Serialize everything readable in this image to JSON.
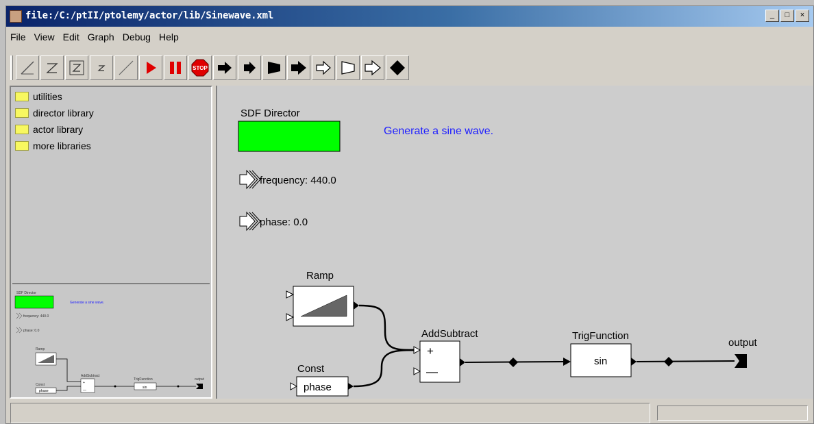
{
  "window": {
    "title": "file:/C:/ptII/ptolemy/actor/lib/Sinewave.xml",
    "buttons": {
      "minimize": "_",
      "maximize": "□",
      "close": "×"
    }
  },
  "menu": [
    "File",
    "View",
    "Edit",
    "Graph",
    "Debug",
    "Help"
  ],
  "toolbar": {
    "buttons": [
      "zoom-reset",
      "zoom-in",
      "zoom-fit",
      "zoom-out",
      "zoom-full",
      "run",
      "pause",
      "stop",
      "fwd-step",
      "fwd-run",
      "fwd-end",
      "fwd-big",
      "back-step",
      "back-run",
      "back-end",
      "diamond"
    ],
    "stop_label": "STOP"
  },
  "library": {
    "items": [
      "utilities",
      "director library",
      "actor library",
      "more libraries"
    ]
  },
  "diagram": {
    "director_label": "SDF Director",
    "annotation": "Generate a sine wave.",
    "param_frequency": "frequency: 440.0",
    "param_phase": "phase: 0.0",
    "ramp_label": "Ramp",
    "const_label": "Const",
    "const_value": "phase",
    "addsub_label": "AddSubtract",
    "plus": "+",
    "minus": "—",
    "trig_label": "TrigFunction",
    "trig_value": "sin",
    "output_label": "output"
  },
  "colors": {
    "director": "#00ff00",
    "annotation": "#2020ff",
    "run": "#e00000",
    "stop": "#e00000"
  },
  "status": {
    "left": "",
    "right": ""
  }
}
